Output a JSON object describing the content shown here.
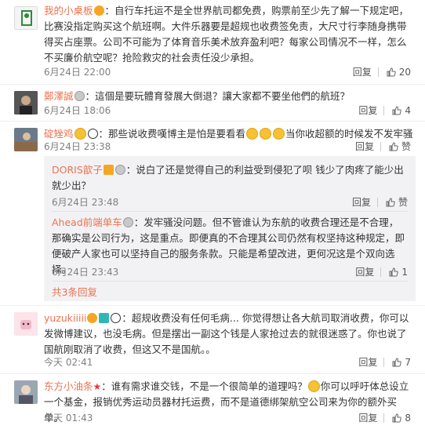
{
  "labels": {
    "reply": "回复",
    "like": "赞"
  },
  "comments": [
    {
      "name": "我的小桌板",
      "text": "：自行车托运不是全世界航司都免费，购票前至少先了解一下规定吧，比赛没指定购买这个航班啊。大件乐器要是超规也收费签免责，大尺寸行李随身携带得买占座票。公司不可能为了体育音乐美术放弃盈利吧？每家公司情况不一样，怎么不买廉价航空呢？抢险救灾的社会责任没少承担。",
      "time": "6月24日 22:00",
      "likes": "20"
    },
    {
      "name": "鄭澤誠",
      "text": "：這個是要玩體育發展大倒退？讓大家都不要坐他們的航班？",
      "time": "6月24日 18:06",
      "likes": "4"
    },
    {
      "name": "碇矬鸡",
      "text_a": "：那些说收费嘆博主是怕是要看看",
      "text_b": "当你收超额的时候发不发牢骚",
      "time": "6月24日 23:38",
      "likes": "赞",
      "replies": [
        {
          "name": "DORIS歆子",
          "text": "：说白了还是觉得自己的利益受到侵犯了呗 钱少了肉疼了能少出就少出？",
          "time": "6月24日 23:48",
          "likes": "赞"
        },
        {
          "name": "Ahead前端单车",
          "text": "：发牢骚没问题。但不管谁认为东航的收费合理还是不合理，那确实是公司行为，这是重点。即便真的不合理其公司仍然有权坚持这种规定，即便破产人家也可以坚持自己的服务条款。只能是希望改进，更何况这是个双向选择。",
          "time": "6月24日 23:43",
          "likes": "1"
        }
      ],
      "more": "共3条回复"
    },
    {
      "name": "yuzukiiiii",
      "text": "：超规收费没有任何毛病... 你觉得想让各大航司取消收费，你可以发微博建议，也没毛病。但是摆出一副这个钱是人家抢过去的就很迷惑了。你也说了国航刚取消了收费，但这又不是国航。。",
      "time": "今天 02:41",
      "likes": "7"
    },
    {
      "name": "东方小油条",
      "text_a": "：谁有需求谁交钱，不是一个很简单的道理吗？",
      "text_b": "你可以呼吁体总设立一个基金，报销优秀运动员器材托运费，而不是道德绑架航空公司来为你的额外买单。",
      "time": "今天 01:43",
      "likes": "8"
    }
  ]
}
